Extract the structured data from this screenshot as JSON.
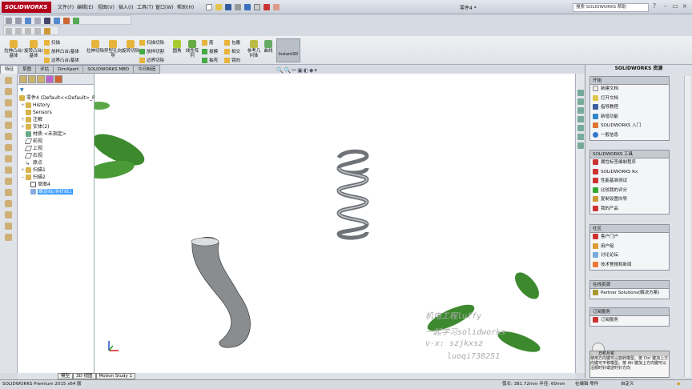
{
  "app": {
    "logo": "SOLIDWORKS",
    "doc_title": "零件4 *",
    "search_placeholder": "搜索 SOLIDWORKS 帮助"
  },
  "menu": [
    "文件(F)",
    "编辑(E)",
    "视图(V)",
    "插入(I)",
    "工具(T)",
    "窗口(W)",
    "帮助(H)"
  ],
  "command_manager": {
    "big": [
      {
        "label": "拉伸凸台/基体"
      },
      {
        "label": "旋转凸台/基体"
      },
      {
        "label": "拉伸切除"
      },
      {
        "label": "异型孔向导"
      },
      {
        "label": "旋转切除"
      },
      {
        "label": "圆角"
      },
      {
        "label": "线性阵列"
      },
      {
        "label": "参考几何体"
      },
      {
        "label": "曲线"
      }
    ],
    "small": [
      "扫描",
      "放样凸台/基体",
      "边界凸台/基体",
      "扫描切除",
      "放样切割",
      "边界切除",
      "筋",
      "拔模",
      "抽壳",
      "包覆",
      "相交",
      "镜向"
    ],
    "instant3d": "Instant3D"
  },
  "tabs": [
    "特征",
    "草图",
    "评估",
    "DimXpert",
    "SOLIDWORKS MBD",
    "今日制造"
  ],
  "tree": {
    "root": "零件4 (Default<<Default>_Ph",
    "nodes": [
      "History",
      "Sensors",
      "注解",
      "实体(2)",
      "材质 <未指定>",
      "前视",
      "上视",
      "右视",
      "原点",
      "扫描1",
      "扫描2",
      "草图4",
      "螺旋线/涡状线1"
    ]
  },
  "task_pane": {
    "title": "SOLIDWORKS 资源",
    "sections": [
      {
        "title": "开始",
        "items": [
          "新建文档",
          "打开文档",
          "指导教程",
          "新增功能",
          "SOLIDWORKS 入门",
          "一般信息"
        ]
      },
      {
        "title": "SOLIDWORKS 工具",
        "items": [
          "属性标签编制程序",
          "SOLIDWORKS Rx",
          "性能基准测试",
          "比较我的评分",
          "复制设置向导",
          "我的产品"
        ]
      },
      {
        "title": "社区",
        "items": [
          "客户门户",
          "用户组",
          "讨论论坛",
          "技术警报和新闻"
        ]
      },
      {
        "title": "在线资源",
        "items": [
          "Partner Solutions(解决方案)"
        ]
      },
      {
        "title": "订阅服务",
        "items": [
          "订阅服务"
        ]
      }
    ],
    "tip_title": "日积月累",
    "tip_text": "使用方向键可以旋转模型。按 Ctrl 键加上方向键可平移模型。按 Alt 键加上方向键可以沿顺时针或逆时针方向"
  },
  "watermark": [
    "机电工程luffy",
    "一起学习solidworks",
    "v-x: szjkxsz",
    "luoqi738251"
  ],
  "bottom_tabs": [
    "模型",
    "3D 视图",
    "Motion Study 1"
  ],
  "status": {
    "left": "SOLIDWORKS Premium 2015 x64 版",
    "measure": "弧长: 381.72mm 半径: 60mm",
    "mode": "在编辑 零件",
    "units": "自定义"
  }
}
